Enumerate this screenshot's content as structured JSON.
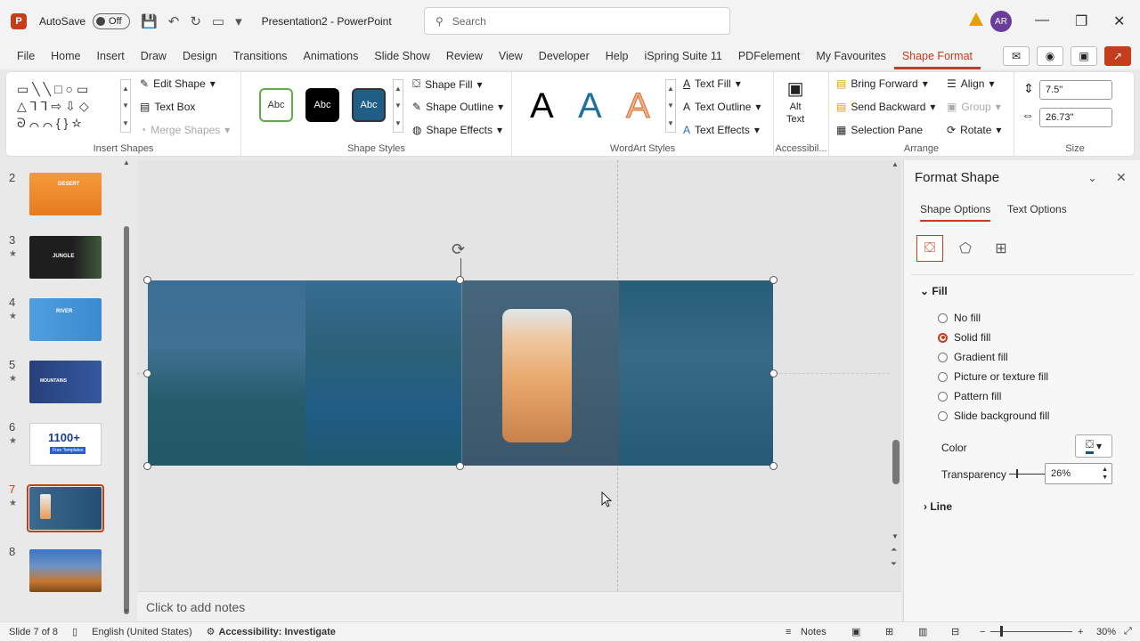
{
  "titlebar": {
    "app_letter": "P",
    "autosave_label": "AutoSave",
    "autosave_state": "Off",
    "doc_title": "Presentation2 - PowerPoint",
    "search_placeholder": "Search",
    "user_initials": "AR"
  },
  "menu": {
    "tabs": [
      "File",
      "Home",
      "Insert",
      "Draw",
      "Design",
      "Transitions",
      "Animations",
      "Slide Show",
      "Review",
      "View",
      "Developer",
      "Help",
      "iSpring Suite 11",
      "PDFelement",
      "My Favourites",
      "Shape Format"
    ],
    "active_tab": "Shape Format"
  },
  "ribbon": {
    "insert_shapes": {
      "label": "Insert Shapes",
      "edit_shape": "Edit Shape",
      "text_box": "Text Box",
      "merge_shapes": "Merge Shapes"
    },
    "shape_styles": {
      "label": "Shape Styles",
      "swatch_text": "Abc",
      "shape_fill": "Shape Fill",
      "shape_outline": "Shape Outline",
      "shape_effects": "Shape Effects"
    },
    "wordart": {
      "label": "WordArt Styles",
      "letter": "A",
      "text_fill": "Text Fill",
      "text_outline": "Text Outline",
      "text_effects": "Text Effects"
    },
    "accessibility": {
      "label": "Accessibil...",
      "alt_text_line1": "Alt",
      "alt_text_line2": "Text"
    },
    "arrange": {
      "label": "Arrange",
      "bring_forward": "Bring Forward",
      "send_backward": "Send Backward",
      "selection_pane": "Selection Pane",
      "align": "Align",
      "group": "Group",
      "rotate": "Rotate"
    },
    "size": {
      "label": "Size",
      "height": "7.5\"",
      "width": "26.73\""
    }
  },
  "slides": [
    {
      "num": "2",
      "title": "DESERT",
      "star": false
    },
    {
      "num": "3",
      "title": "JUNGLE",
      "star": true
    },
    {
      "num": "4",
      "title": "RIVER",
      "star": true
    },
    {
      "num": "5",
      "title": "MOUNTAINS",
      "star": true
    },
    {
      "num": "6",
      "title": "1100+",
      "subtitle": "Free Templates",
      "star": true
    },
    {
      "num": "7",
      "title": "",
      "star": true
    },
    {
      "num": "8",
      "title": "",
      "star": false
    }
  ],
  "active_slide": "7",
  "notes_placeholder": "Click to add notes",
  "format_pane": {
    "title": "Format Shape",
    "tab_shape_options": "Shape Options",
    "tab_text_options": "Text Options",
    "fill_label": "Fill",
    "fill_options": [
      "No fill",
      "Solid fill",
      "Gradient fill",
      "Picture or texture fill",
      "Pattern fill",
      "Slide background fill"
    ],
    "fill_selected": "Solid fill",
    "color_label": "Color",
    "transparency_label": "Transparency",
    "transparency_value": "26%",
    "line_label": "Line"
  },
  "statusbar": {
    "slide_info": "Slide 7 of 8",
    "language": "English (United States)",
    "accessibility": "Accessibility: Investigate",
    "notes": "Notes",
    "zoom": "30%"
  },
  "colors": {
    "accent": "#c43e1c",
    "overlay": "#18527c"
  }
}
